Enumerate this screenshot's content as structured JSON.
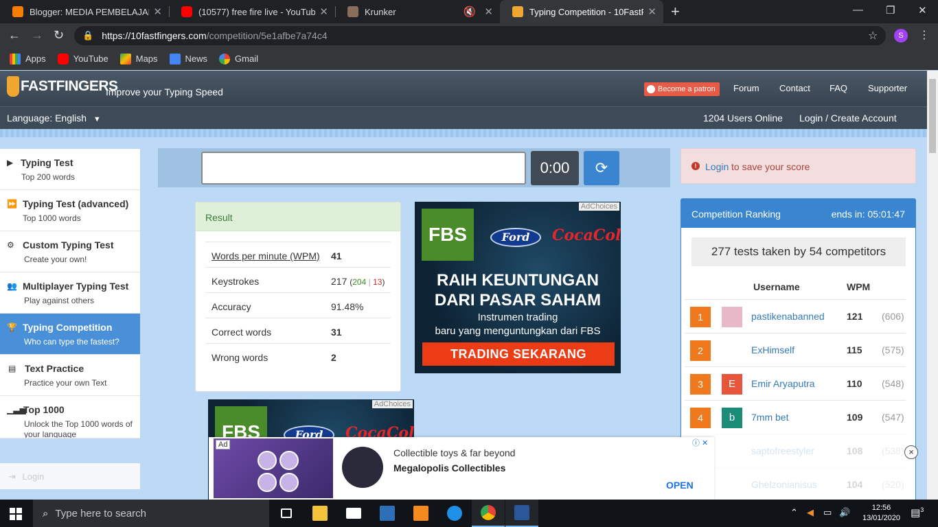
{
  "browser": {
    "tabs": [
      {
        "title": "Blogger: MEDIA PEMBELAJARAN",
        "icon": "blogger-icon",
        "color": "#f57d00"
      },
      {
        "title": "(10577) free fire live - YouTube",
        "icon": "youtube-icon",
        "color": "#ff0000"
      },
      {
        "title": "Krunker",
        "icon": "krunker-icon",
        "color": "#8a6d5a"
      },
      {
        "title": "Typing Competition - 10FastFinge",
        "icon": "10fastfingers-icon",
        "color": "#f0a732"
      }
    ],
    "new_tab": "+",
    "url_host": "https://10fastfingers.com",
    "url_path": "/competition/5e1afbe7a74c4",
    "profile_initial": "S",
    "bookmarks": [
      "Apps",
      "YouTube",
      "Maps",
      "News",
      "Gmail"
    ]
  },
  "site": {
    "logo_text": "FASTFINGERS",
    "tagline": "Improve your Typing Speed",
    "patron_label": "Become a patron",
    "nav": [
      "Forum",
      "Contact",
      "FAQ",
      "Supporter"
    ],
    "language_label": "Language: English",
    "users_online": "1204 Users Online",
    "login_create": "Login / Create Account"
  },
  "sidebar": {
    "items": [
      {
        "title": "Typing Test",
        "sub": "Top 200 words",
        "icon": "play-icon"
      },
      {
        "title": "Typing Test (advanced)",
        "sub": "Top 1000 words",
        "icon": "fast-forward-icon"
      },
      {
        "title": "Custom Typing Test",
        "sub": "Create your own!",
        "icon": "cogs-icon"
      },
      {
        "title": "Multiplayer Typing Test",
        "sub": "Play against others",
        "icon": "users-icon"
      },
      {
        "title": "Typing Competition",
        "sub": "Who can type the fastest?",
        "icon": "trophy-icon",
        "active": true
      },
      {
        "title": "Text Practice",
        "sub": "Practice your own Text",
        "icon": "document-icon"
      },
      {
        "title": "Top 1000",
        "sub": "Unlock the Top 1000 words of your language",
        "icon": "signal-icon"
      }
    ],
    "login": "Login"
  },
  "test": {
    "input_value": "",
    "timer": "0:00"
  },
  "result": {
    "heading": "Result",
    "wpm_label": "Words per minute (WPM)",
    "wpm_value": "41",
    "keystrokes_label": "Keystrokes",
    "keystrokes_total": "217",
    "keystrokes_correct": "204",
    "keystrokes_sep": "|",
    "keystrokes_wrong": "13",
    "accuracy_label": "Accuracy",
    "accuracy_value": "91.48%",
    "correct_label": "Correct words",
    "correct_value": "31",
    "wrong_label": "Wrong words",
    "wrong_value": "2"
  },
  "ad": {
    "adchoices": "AdChoices",
    "brand1": "FBS",
    "brand2": "Ford",
    "brand3": "CocaCola",
    "headline_1": "RAIH KEUNTUNGAN",
    "headline_2": "DARI PASAR SAHAM",
    "sub_1": "Instrumen trading",
    "sub_2": "baru yang menguntungkan dari FBS",
    "cta": "TRADING SEKARANG"
  },
  "alert": {
    "link": "Login",
    "text": "to save your score"
  },
  "ranking": {
    "title": "Competition Ranking",
    "ends": "ends in: 05:01:47",
    "summary": "277 tests taken by 54 competitors",
    "col_username": "Username",
    "col_wpm": "WPM",
    "rows": [
      {
        "rank": "1",
        "avatar": "",
        "avatar_color": "#e9b8c8",
        "user": "pastikenabanned",
        "wpm": "121",
        "total": "(606)"
      },
      {
        "rank": "2",
        "avatar": "",
        "avatar_color": "#ffffff",
        "user": "ExHimself",
        "wpm": "115",
        "total": "(575)"
      },
      {
        "rank": "3",
        "avatar": "E",
        "avatar_color": "#e8553a",
        "user": "Emir Aryaputra",
        "wpm": "110",
        "total": "(548)"
      },
      {
        "rank": "4",
        "avatar": "b",
        "avatar_color": "#1a8c78",
        "user": "7mm bet",
        "wpm": "109",
        "total": "(547)"
      },
      {
        "rank": "5",
        "avatar": "",
        "avatar_color": "#ffffff",
        "user": "saptofreestyler",
        "wpm": "108",
        "total": "(538)"
      },
      {
        "rank": "6",
        "avatar": "",
        "avatar_color": "#ffffff",
        "user": "Ghelzonianisus",
        "wpm": "104",
        "total": "(520)"
      }
    ]
  },
  "bottom_ad": {
    "badge": "Ad",
    "line1": "Collectible toys & far beyond",
    "line2": "Megalopolis Collectibles",
    "open": "OPEN",
    "close": "×"
  },
  "taskbar": {
    "search_placeholder": "Type here to search",
    "time": "12:56",
    "date": "13/01/2020",
    "notifications": "3"
  }
}
